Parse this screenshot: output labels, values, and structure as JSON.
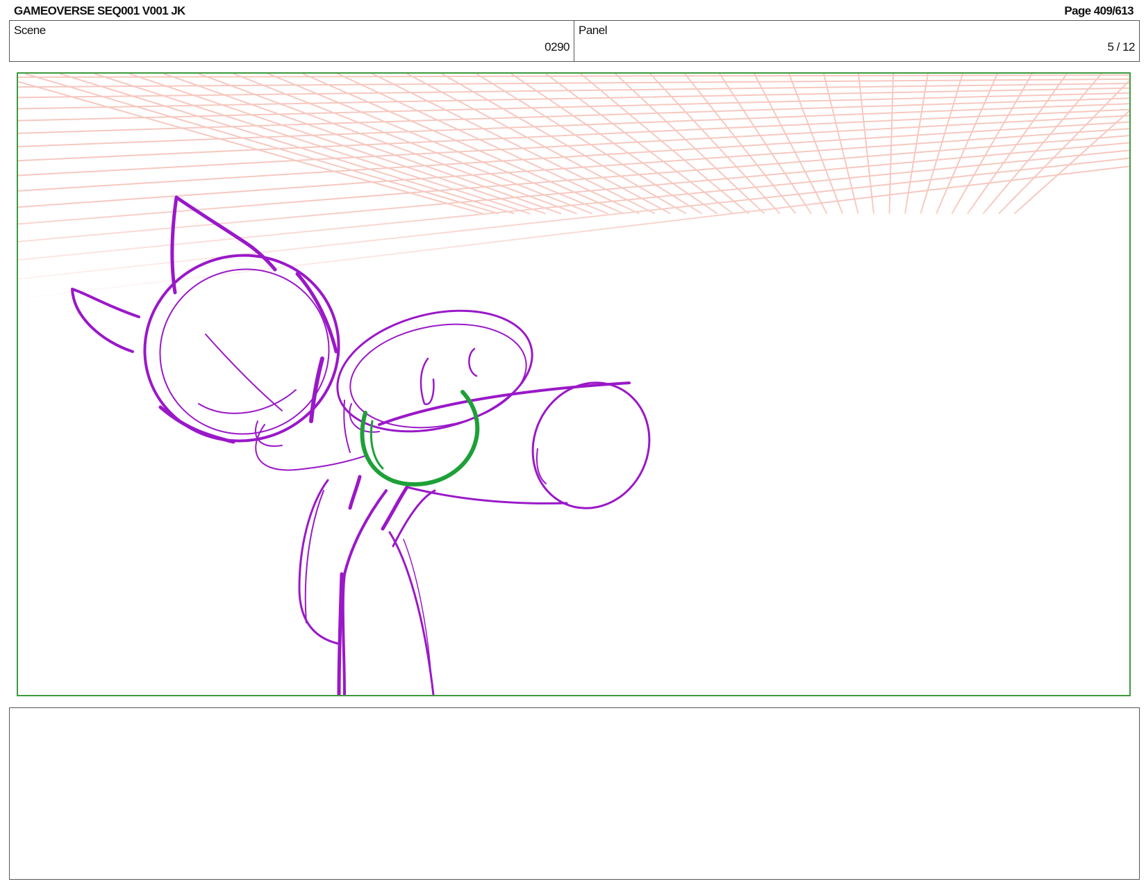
{
  "header": {
    "title": "GAMEOVERSE SEQ001 V001 JK",
    "page": "Page 409/613"
  },
  "scene": {
    "label": "Scene",
    "value": "0290"
  },
  "panel": {
    "label": "Panel",
    "value": "5 / 12"
  },
  "drawing": {
    "character_color": "#9a18c8",
    "accent_color": "#1ea038",
    "grid_color": "#f6c8c0",
    "frame_color": "#3c9a3c"
  },
  "notes": {
    "text": ""
  }
}
